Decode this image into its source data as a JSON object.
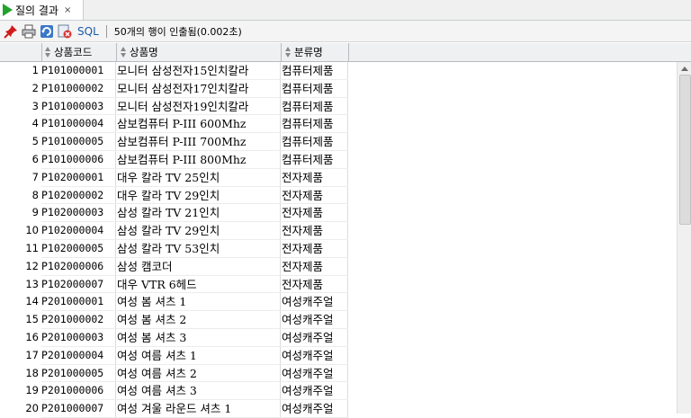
{
  "tab": {
    "title": "질의 결과",
    "close": "×"
  },
  "toolbar": {
    "sql_label": "SQL",
    "message": "50개의 행이 인출됨(0.002초)"
  },
  "columns": [
    "상품코드",
    "상품명",
    "분류명"
  ],
  "rows": [
    {
      "n": "1",
      "code": "P101000001",
      "name": "모니터 삼성전자15인치칼라",
      "cat": "컴퓨터제품"
    },
    {
      "n": "2",
      "code": "P101000002",
      "name": "모니터 삼성전자17인치칼라",
      "cat": "컴퓨터제품"
    },
    {
      "n": "3",
      "code": "P101000003",
      "name": "모니터 삼성전자19인치칼라",
      "cat": "컴퓨터제품"
    },
    {
      "n": "4",
      "code": "P101000004",
      "name": "삼보컴퓨터 P-III 600Mhz",
      "cat": "컴퓨터제품"
    },
    {
      "n": "5",
      "code": "P101000005",
      "name": "삼보컴퓨터 P-III 700Mhz",
      "cat": "컴퓨터제품"
    },
    {
      "n": "6",
      "code": "P101000006",
      "name": "삼보컴퓨터 P-III 800Mhz",
      "cat": "컴퓨터제품"
    },
    {
      "n": "7",
      "code": "P102000001",
      "name": "대우 칼라 TV 25인치",
      "cat": "전자제품"
    },
    {
      "n": "8",
      "code": "P102000002",
      "name": "대우 칼라 TV 29인치",
      "cat": "전자제품"
    },
    {
      "n": "9",
      "code": "P102000003",
      "name": "삼성 칼라 TV 21인치",
      "cat": "전자제품"
    },
    {
      "n": "10",
      "code": "P102000004",
      "name": "삼성 칼라 TV 29인치",
      "cat": "전자제품"
    },
    {
      "n": "11",
      "code": "P102000005",
      "name": "삼성 칼라 TV 53인치",
      "cat": "전자제품"
    },
    {
      "n": "12",
      "code": "P102000006",
      "name": "삼성 캠코더",
      "cat": "전자제품"
    },
    {
      "n": "13",
      "code": "P102000007",
      "name": "대우 VTR 6헤드",
      "cat": "전자제품"
    },
    {
      "n": "14",
      "code": "P201000001",
      "name": "여성 봄 셔츠 1",
      "cat": "여성캐주얼"
    },
    {
      "n": "15",
      "code": "P201000002",
      "name": "여성 봄 셔츠 2",
      "cat": "여성캐주얼"
    },
    {
      "n": "16",
      "code": "P201000003",
      "name": "여성 봄 셔츠 3",
      "cat": "여성캐주얼"
    },
    {
      "n": "17",
      "code": "P201000004",
      "name": "여성 여름 셔츠 1",
      "cat": "여성캐주얼"
    },
    {
      "n": "18",
      "code": "P201000005",
      "name": "여성 여름 셔츠 2",
      "cat": "여성캐주얼"
    },
    {
      "n": "19",
      "code": "P201000006",
      "name": "여성 여름 셔츠 3",
      "cat": "여성캐주얼"
    },
    {
      "n": "20",
      "code": "P201000007",
      "name": "여성 겨울 라운드 셔츠 1",
      "cat": "여성캐주얼"
    }
  ]
}
